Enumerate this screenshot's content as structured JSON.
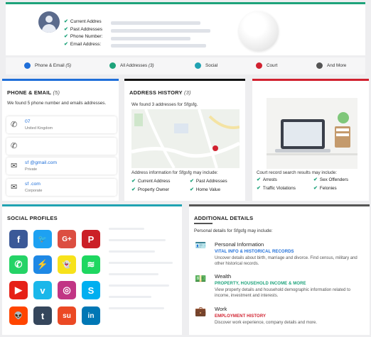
{
  "profile": {
    "checklist": [
      "Current Addres",
      "Past Addresses",
      "Phone Number:",
      "Email Address:"
    ]
  },
  "nav": [
    {
      "label": "Phone & Email",
      "count": "(5)",
      "color": "#1f6fd9"
    },
    {
      "label": "All Addresses",
      "count": "(3)",
      "color": "#1ea37b"
    },
    {
      "label": "Social",
      "count": "",
      "color": "#20a2b2"
    },
    {
      "label": "Court",
      "count": "",
      "color": "#d1212f"
    },
    {
      "label": "And More",
      "count": "",
      "color": "#555555"
    }
  ],
  "phone_email": {
    "title": "PHONE & EMAIL",
    "count": "(5)",
    "summary": "We found 5 phone number and emails addresses.",
    "entries": [
      {
        "icon": "phone-icon",
        "value": "07",
        "sub": "United Kingdom"
      },
      {
        "icon": "phone-icon",
        "value": "",
        "sub": ""
      },
      {
        "icon": "envelope-icon",
        "value": "sf          @gmail.com",
        "sub": "Private"
      },
      {
        "icon": "envelope-icon",
        "value": "sf                .com",
        "sub": "Corporate"
      }
    ]
  },
  "address_history": {
    "title": "ADDRESS HISTORY",
    "count": "(3)",
    "summary": "We found 3 addresses for Sfgsfg.",
    "info": "Address information for Sfgsfg may include:",
    "features": [
      "Current Address",
      "Past Addresses",
      "Property Owner",
      "Home Value"
    ]
  },
  "court": {
    "info": "Court record search results may include:",
    "features": [
      "Arrests",
      "Sex Offenders",
      "Traffic Violations",
      "Felonies"
    ]
  },
  "social": {
    "title": "SOCIAL PROFILES",
    "icons": [
      {
        "name": "facebook-icon",
        "glyph": "f",
        "color": "#3b5998"
      },
      {
        "name": "twitter-icon",
        "glyph": "🐦",
        "color": "#1da1f2"
      },
      {
        "name": "google-plus-icon",
        "glyph": "G+",
        "color": "#dc4e41"
      },
      {
        "name": "pinterest-icon",
        "glyph": "P",
        "color": "#cb2027"
      },
      {
        "name": "whatsapp-icon",
        "glyph": "✆",
        "color": "#25d366"
      },
      {
        "name": "messenger-icon",
        "glyph": "⚡",
        "color": "#1e88e5"
      },
      {
        "name": "snapchat-icon",
        "glyph": "👻",
        "color": "#f7e21b"
      },
      {
        "name": "spotify-icon",
        "glyph": "≋",
        "color": "#1ed760"
      },
      {
        "name": "youtube-icon",
        "glyph": "▶",
        "color": "#e62117"
      },
      {
        "name": "vimeo-icon",
        "glyph": "v",
        "color": "#1ab7ea"
      },
      {
        "name": "instagram-icon",
        "glyph": "◎",
        "color": "#c13584"
      },
      {
        "name": "skype-icon",
        "glyph": "S",
        "color": "#00aff0"
      },
      {
        "name": "reddit-icon",
        "glyph": "👽",
        "color": "#ff4500"
      },
      {
        "name": "tumblr-icon",
        "glyph": "t",
        "color": "#35465c"
      },
      {
        "name": "stumbleupon-icon",
        "glyph": "su",
        "color": "#eb4924"
      },
      {
        "name": "linkedin-icon",
        "glyph": "in",
        "color": "#0077b5"
      }
    ]
  },
  "additional": {
    "title": "ADDITIONAL DETAILS",
    "intro": "Personal details for Sfgsfg may include:",
    "sections": [
      {
        "icon": "id-card-icon",
        "title": "Personal Information",
        "link": "VITAL INFO & HISTORICAL RECORDS",
        "link_color": "#1f6fd9",
        "desc": "Uncover details about birth, marriage and divorce. Find census, military and other historical records."
      },
      {
        "icon": "money-hand-icon",
        "title": "Wealth",
        "link": "PROPERTY, HOUSEHOLD INCOME & MORE",
        "link_color": "#1ea37b",
        "desc": "View property details and household demographic information related to income, investment and interests."
      },
      {
        "icon": "briefcase-icon",
        "title": "Work",
        "link": "EMPLOYMENT HISTORY",
        "link_color": "#d1212f",
        "desc": "Discover work experience, company details and more."
      }
    ]
  }
}
